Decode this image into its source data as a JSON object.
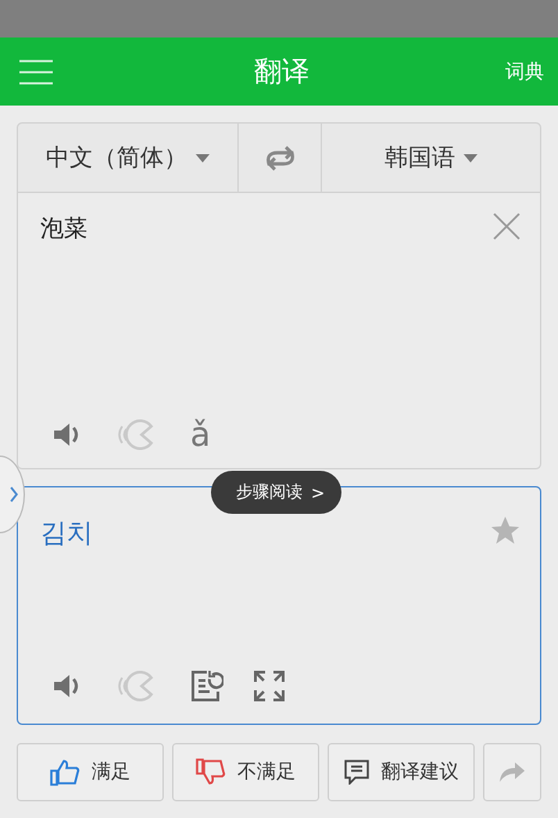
{
  "header": {
    "title": "翻译",
    "action": "词典"
  },
  "languages": {
    "source": "中文（简体）",
    "target": "韩国语"
  },
  "source": {
    "text": "泡菜",
    "pinyin": "ǎ"
  },
  "result": {
    "text": "김치",
    "starred": false
  },
  "tooltip": {
    "text": "步骤阅读",
    "arrow": ">"
  },
  "feedback": [
    {
      "kind": "like",
      "label": "满足"
    },
    {
      "kind": "dislike",
      "label": "不满足"
    },
    {
      "kind": "suggest",
      "label": "翻译建议"
    },
    {
      "kind": "share"
    }
  ]
}
